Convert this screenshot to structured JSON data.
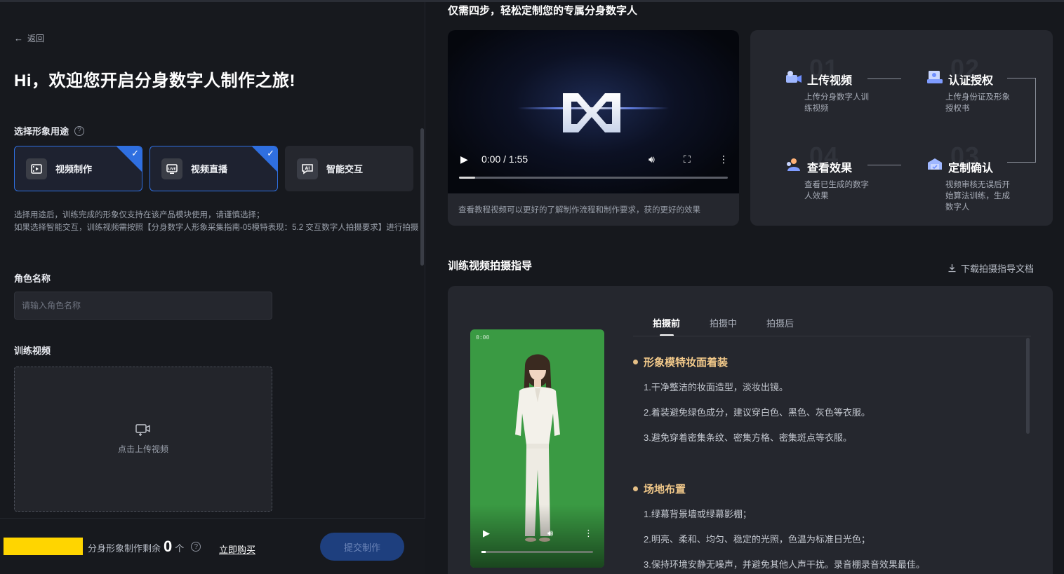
{
  "left": {
    "back_label": "返回",
    "welcome_title": "Hi，欢迎您开启分身数字人制作之旅!",
    "purpose_label": "选择形象用途",
    "purpose_cards": [
      {
        "label": "视频制作",
        "icon": "film-icon",
        "selected": true
      },
      {
        "label": "视频直播",
        "icon": "live-icon",
        "selected": true
      },
      {
        "label": "智能交互",
        "icon": "ai-chat-icon",
        "selected": false
      }
    ],
    "note_line1": "选择用途后，训练完成的形象仅支持在该产品模块使用，请谨慎选择；",
    "note_line2": "如果选择智能交互，训练视频需按照【分身数字人形象采集指南-05模特表现：5.2 交互数字人拍摄要求】进行拍摄",
    "role_name_label": "角色名称",
    "role_name_placeholder": "请输入角色名称",
    "role_name_value": "",
    "training_video_label": "训练视频",
    "upload_text": "点击上传视频",
    "remaining_prefix": "分身形象制作剩余",
    "remaining_count": "0",
    "remaining_unit": "个",
    "buy_label": "立即购买",
    "submit_label": "提交制作"
  },
  "right": {
    "steps_title": "仅需四步，轻松定制您的专属分身数字人",
    "video": {
      "time": "0:00 / 1:55",
      "progress": 0.06,
      "caption": "查看教程视频可以更好的了解制作流程和制作要求，获的更好的效果"
    },
    "steps": [
      {
        "num": "01",
        "name": "上传视频",
        "desc": "上传分身数字人训练视频",
        "icon": "upload-video-icon"
      },
      {
        "num": "02",
        "name": "认证授权",
        "desc": "上传身份证及形象授权书",
        "icon": "auth-icon"
      },
      {
        "num": "03",
        "name": "定制确认",
        "desc": "视频审核无误后开始算法训练，生成数字人",
        "icon": "confirm-icon"
      },
      {
        "num": "04",
        "name": "查看效果",
        "desc": "查看已生成的数字人效果",
        "icon": "view-result-icon"
      }
    ],
    "guide_title": "训练视频拍摄指导",
    "download_label": "下载拍摄指导文档",
    "tabs": [
      "拍摄前",
      "拍摄中",
      "拍摄后"
    ],
    "active_tab": 0,
    "phone_time": "0:00",
    "sections": [
      {
        "title": "形象模特妆面着装",
        "lines": [
          "1.干净整洁的妆面造型，淡妆出镜。",
          "2.着装避免绿色成分，建议穿白色、黑色、灰色等衣服。",
          "3.避免穿着密集条纹、密集方格、密集斑点等衣服。"
        ]
      },
      {
        "title": "场地布置",
        "lines": [
          "1.绿幕背景墙或绿幕影棚；",
          "2.明亮、柔和、均匀、稳定的光照，色温为标准日光色；",
          "3.保持环境安静无噪声，并避免其他人声干扰。录音棚录音效果最佳。"
        ]
      }
    ]
  },
  "colors": {
    "accent": "#2f6fe0",
    "section_title": "#f2c98a",
    "green_screen": "#3a9a43",
    "highlight_yellow": "#ffd500"
  }
}
